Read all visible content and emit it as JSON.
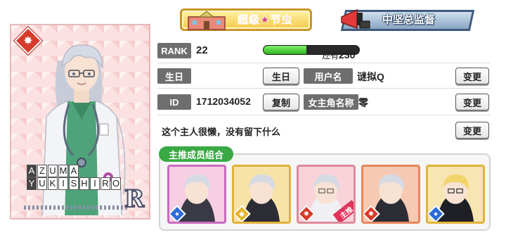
{
  "colors": {
    "accent_green": "#39a943",
    "label_gray": "#6e6e6e",
    "xp_fill": "#2fb51f",
    "attr_red": "#d63b2c",
    "attr_blue": "#2d6ed8",
    "attr_yellow": "#e7b52a"
  },
  "card": {
    "attribute_icon": "burst-icon",
    "name_line1": [
      "A",
      "Z",
      "U",
      "M",
      "A"
    ],
    "name_line2": [
      "Y",
      "U",
      "K",
      "I",
      "S",
      "H",
      "I",
      "R",
      "O"
    ],
    "rarity": "R"
  },
  "titles": {
    "title1": "超级★节虫",
    "title2": "中坚总监督"
  },
  "profile": {
    "rank_label": "RANK",
    "rank_value": "22",
    "xp_progress": 0.45,
    "xp_remaining_prefix": "还有",
    "xp_remaining_value": "230",
    "birthday_label": "生日",
    "birthday_button": "生日",
    "username_label": "用户名",
    "username_value": "谜拟Q",
    "change_button": "变更",
    "id_label": "ID",
    "id_value": "1712034052",
    "copy_button": "复制",
    "heroine_label": "女主角名称",
    "heroine_value": "零",
    "bio": "这个主人很懒，没有留下什么"
  },
  "favorites": {
    "title": "主推成员组合",
    "main_tag": "主推",
    "members": [
      {
        "attribute": "blue",
        "icon": "drop-icon"
      },
      {
        "attribute": "yellow",
        "icon": "diamond-icon"
      },
      {
        "attribute": "red",
        "icon": "burst-icon"
      },
      {
        "attribute": "red",
        "icon": "burst-icon"
      },
      {
        "attribute": "blue",
        "icon": "drop-icon"
      }
    ]
  }
}
